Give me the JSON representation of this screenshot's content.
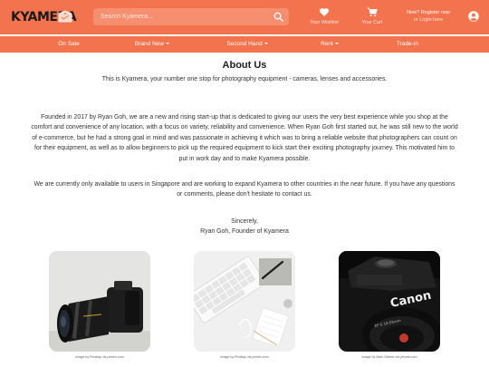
{
  "brand": {
    "name": "KYAMERA"
  },
  "search": {
    "placeholder": "Search Kyamera..."
  },
  "header": {
    "wishlist_label": "Your Wishlist",
    "cart_label": "Your Cart",
    "register_line1": "New? Register now",
    "register_line2": "or Login here"
  },
  "nav": {
    "items": [
      {
        "label": "On Sale"
      },
      {
        "label": "Brand New"
      },
      {
        "label": "Second Hand"
      },
      {
        "label": "Rent"
      },
      {
        "label": "Trade-in"
      }
    ]
  },
  "about": {
    "title": "About Us",
    "intro": "This is Kyamera, your number one stop for photography equipment - cameras, lenses and accessories.",
    "story": "Founded in 2017 by Ryan Goh, we are a new and rising start-up that is dedicated to giving our users the very best experience while you shop at the comfort and convenience of any location, with a focus on variety, reliability and convenience. When Ryan Goh first started out, he was still new to the world of e-commerce, but he had a strong goal in mind and was passionate in achieving it which was to bring a reliable website that photographers can count on for their equipment, as well as to allow beginners to pick up the required equipment to kick start their exciting photography journey. This motivated him to put in work day and to make Kyamera possible.",
    "availability": "We are currently only available to users in Singapore and are working to expand Kyamera to other countries in the near future. If you have any questions or comments, please don't hesitate to contact us.",
    "signoff": "Sincerely,",
    "signature": "Ryan Goh, Founder of Kyamera"
  },
  "photos": [
    {
      "credit": "Image by Pixabay via pexels.com"
    },
    {
      "credit": "Image by Pixabay via pexels.com"
    },
    {
      "credit": "Image by Mark Sleeter via pexels.com"
    }
  ],
  "colors": {
    "accent": "#f2734d",
    "accent_light": "#f68f70"
  },
  "icons": [
    "search-icon",
    "heart-icon",
    "cart-icon",
    "user-icon",
    "price-tag-icon"
  ]
}
